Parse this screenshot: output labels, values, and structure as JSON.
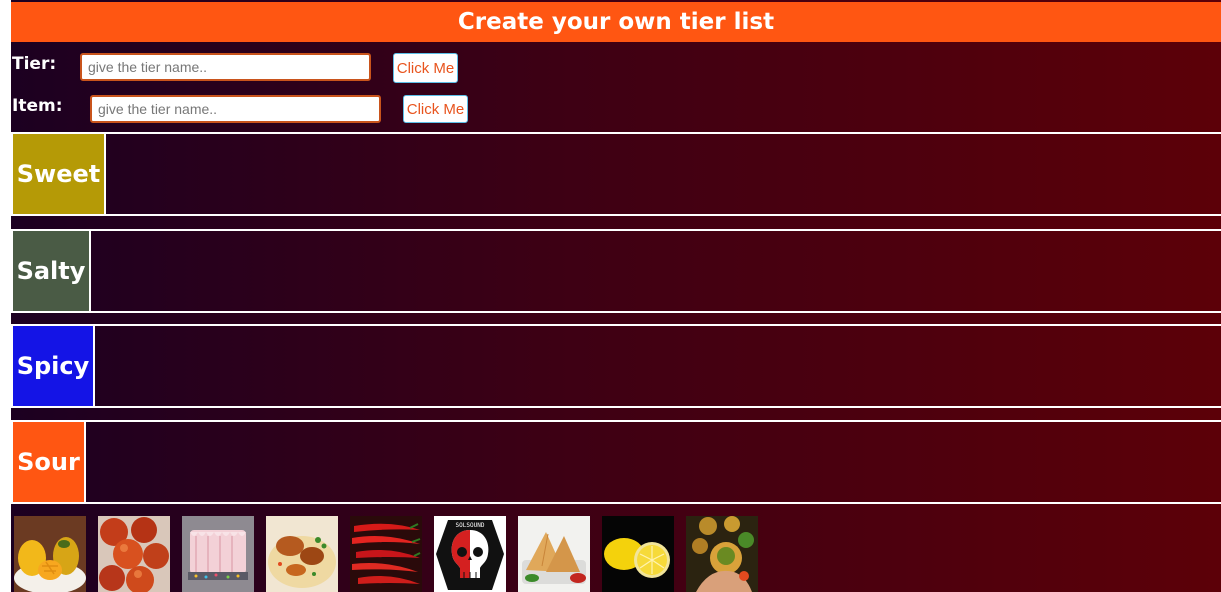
{
  "header": {
    "title": "Create your own tier list",
    "color": "#ff5612"
  },
  "form": {
    "tier": {
      "label": "Tier:",
      "placeholder": "give the tier name..",
      "button_label": "Click Me"
    },
    "item": {
      "label": "Item:",
      "placeholder": "give the tier name..",
      "button_label": "Click Me"
    }
  },
  "tiers": [
    {
      "label": "Sweet",
      "color": "#b59a06"
    },
    {
      "label": "Salty",
      "color": "#4a5b45"
    },
    {
      "label": "Spicy",
      "color": "#1414e6"
    },
    {
      "label": "Sour",
      "color": "#ff5612"
    }
  ],
  "items": [
    {
      "icon": "mango-image"
    },
    {
      "icon": "gulab-jamun-image"
    },
    {
      "icon": "cake-image"
    },
    {
      "icon": "biryani-image"
    },
    {
      "icon": "chili-peppers-image"
    },
    {
      "icon": "skull-poster-image",
      "caption": "SOLSOUND"
    },
    {
      "icon": "samosa-image"
    },
    {
      "icon": "lemon-image"
    },
    {
      "icon": "pani-puri-image"
    }
  ]
}
